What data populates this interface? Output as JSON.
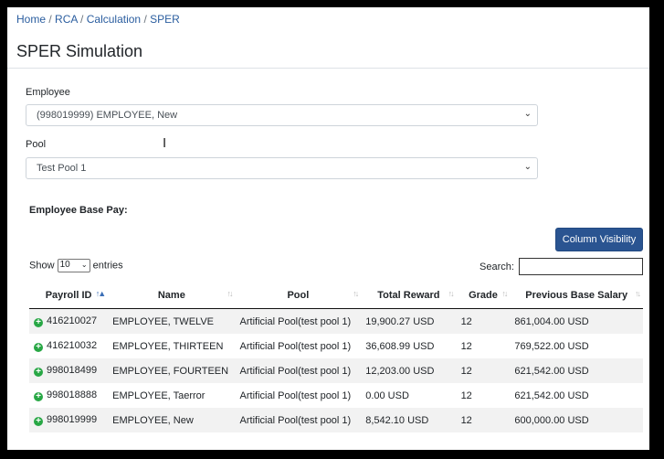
{
  "breadcrumb": [
    {
      "label": "Home"
    },
    {
      "label": "RCA"
    },
    {
      "label": "Calculation"
    },
    {
      "label": "SPER"
    }
  ],
  "page_title": "SPER Simulation",
  "form": {
    "employee_label": "Employee",
    "employee_value": "(998019999) EMPLOYEE, New",
    "pool_label": "Pool",
    "pool_value": "Test Pool 1"
  },
  "section_title": "Employee Base Pay:",
  "column_visibility_label": "Column Visibility",
  "length": {
    "show": "Show",
    "value": "10",
    "entries": "entries"
  },
  "search": {
    "label": "Search:",
    "value": ""
  },
  "table": {
    "columns": [
      "Payroll ID",
      "Name",
      "Pool",
      "Total Reward",
      "Grade",
      "Previous Base Salary"
    ],
    "rows": [
      [
        "416210027",
        "EMPLOYEE, TWELVE",
        "Artificial Pool(test pool 1)",
        "19,900.27 USD",
        "12",
        "861,004.00 USD"
      ],
      [
        "416210032",
        "EMPLOYEE, THIRTEEN",
        "Artificial Pool(test pool 1)",
        "36,608.99 USD",
        "12",
        "769,522.00 USD"
      ],
      [
        "998018499",
        "EMPLOYEE, FOURTEEN",
        "Artificial Pool(test pool 1)",
        "12,203.00 USD",
        "12",
        "621,542.00 USD"
      ],
      [
        "998018888",
        "EMPLOYEE, Taerror",
        "Artificial Pool(test pool 1)",
        "0.00 USD",
        "12",
        "621,542.00 USD"
      ],
      [
        "998019999",
        "EMPLOYEE, New",
        "Artificial Pool(test pool 1)",
        "8,542.10 USD",
        "12",
        "600,000.00 USD"
      ]
    ]
  },
  "colors": {
    "accent": "#2a5491",
    "link": "#2a5d9f",
    "expand": "#28a745"
  }
}
